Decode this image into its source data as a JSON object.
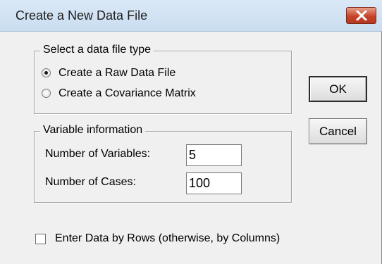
{
  "window": {
    "title": "Create a New Data File"
  },
  "file_type_group": {
    "title": "Select a data file type",
    "options": [
      {
        "label": "Create a Raw Data File",
        "selected": true
      },
      {
        "label": "Create a Covariance Matrix",
        "selected": false
      }
    ]
  },
  "variable_group": {
    "title": "Variable information",
    "num_variables_label": "Number of Variables:",
    "num_variables_value": "5",
    "num_cases_label": "Number of Cases:",
    "num_cases_value": "100"
  },
  "buttons": {
    "ok_label": "OK",
    "cancel_label": "Cancel"
  },
  "enter_by_rows": {
    "label": "Enter Data by Rows (otherwise, by Columns)",
    "checked": false
  },
  "colors": {
    "close_button": "#c7442a",
    "titlebar": "#c9dcf0",
    "dialog_background": "#f0f0f0"
  }
}
